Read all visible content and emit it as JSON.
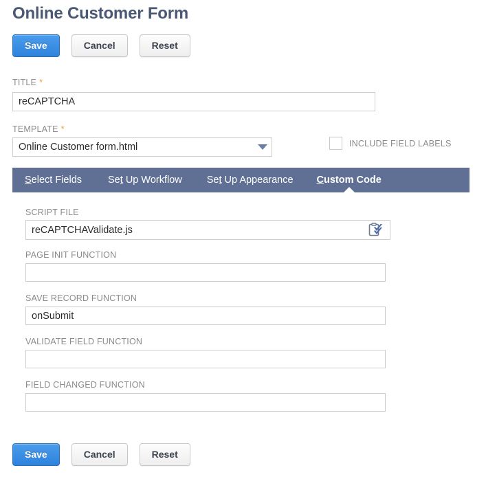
{
  "page": {
    "title": "Online Customer Form"
  },
  "toolbar_top": {
    "save_label": "Save",
    "cancel_label": "Cancel",
    "reset_label": "Reset"
  },
  "toolbar_bottom": {
    "save_label": "Save",
    "cancel_label": "Cancel",
    "reset_label": "Reset"
  },
  "fields": {
    "title": {
      "label": "TITLE",
      "required_marker": "*",
      "value": "reCAPTCHA",
      "placeholder": ""
    },
    "template": {
      "label": "TEMPLATE",
      "required_marker": "*",
      "value": "Online Customer form.html",
      "caret_icon": "chevron-down-icon"
    },
    "include_field_labels": {
      "label": "INCLUDE FIELD LABELS",
      "checked": false
    }
  },
  "tabs": [
    {
      "label": "Select Fields",
      "accesskey": "S",
      "rest": "elect Fields",
      "active": false
    },
    {
      "label": "Set Up Workflow",
      "prefix": "Se",
      "accesskey": "t",
      "rest": " Up Workflow",
      "active": false
    },
    {
      "label": "Set Up Appearance",
      "prefix": "Se",
      "accesskey": "t",
      "rest": " Up Appearance",
      "active": false
    },
    {
      "label": "Custom Code",
      "accesskey": "C",
      "rest": "ustom Code",
      "active": true
    }
  ],
  "custom_code_panel": {
    "script_file": {
      "label": "SCRIPT FILE",
      "value": "reCAPTCHAValidate.js",
      "placeholder": "",
      "lookup_icon": "clipboard-chevron-down-icon"
    },
    "page_init_function": {
      "label": "PAGE INIT FUNCTION",
      "value": "",
      "placeholder": ""
    },
    "save_record_function": {
      "label": "SAVE RECORD FUNCTION",
      "value": "onSubmit",
      "placeholder": ""
    },
    "validate_field_function": {
      "label": "VALIDATE FIELD FUNCTION",
      "value": "",
      "placeholder": ""
    },
    "field_changed_function": {
      "label": "FIELD CHANGED FUNCTION",
      "value": "",
      "placeholder": ""
    }
  },
  "colors": {
    "heading": "#4a5874",
    "tabbar": "#5f7094",
    "primary_button": "#2f82dd",
    "required_star": "#e8a33d",
    "label_text": "#8b8b8b",
    "input_border": "#cccccc"
  }
}
